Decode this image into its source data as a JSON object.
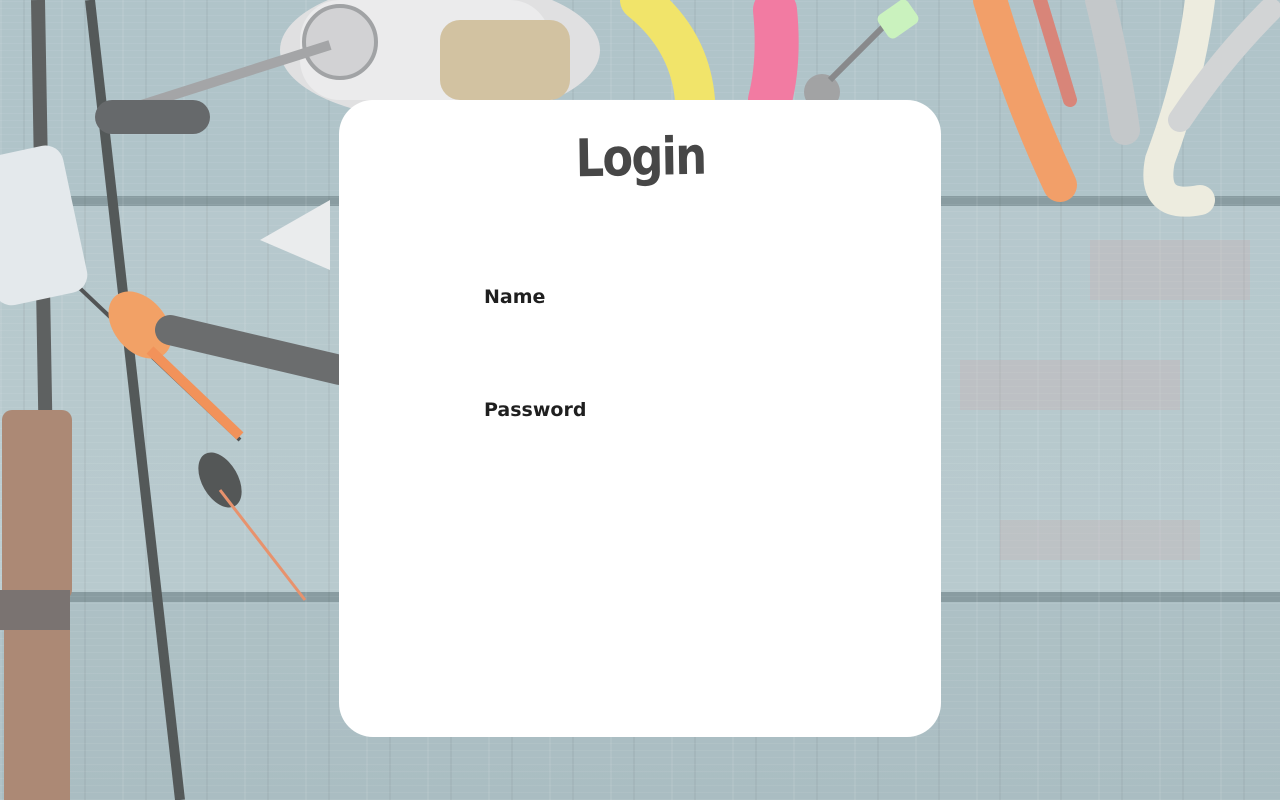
{
  "login": {
    "title": "Login",
    "name_label": "Name",
    "name_value": "",
    "password_label": "Password",
    "password_value": ""
  },
  "background": {
    "description_icons": [
      "fishing-rod-icon",
      "fishing-reel-icon",
      "fishing-float-icon",
      "soft-lure-icon",
      "sinker-icon"
    ]
  },
  "colors": {
    "card": "#ffffff",
    "title": "#474747",
    "label": "#1f1f1f",
    "wood": "#a7bcc2"
  }
}
